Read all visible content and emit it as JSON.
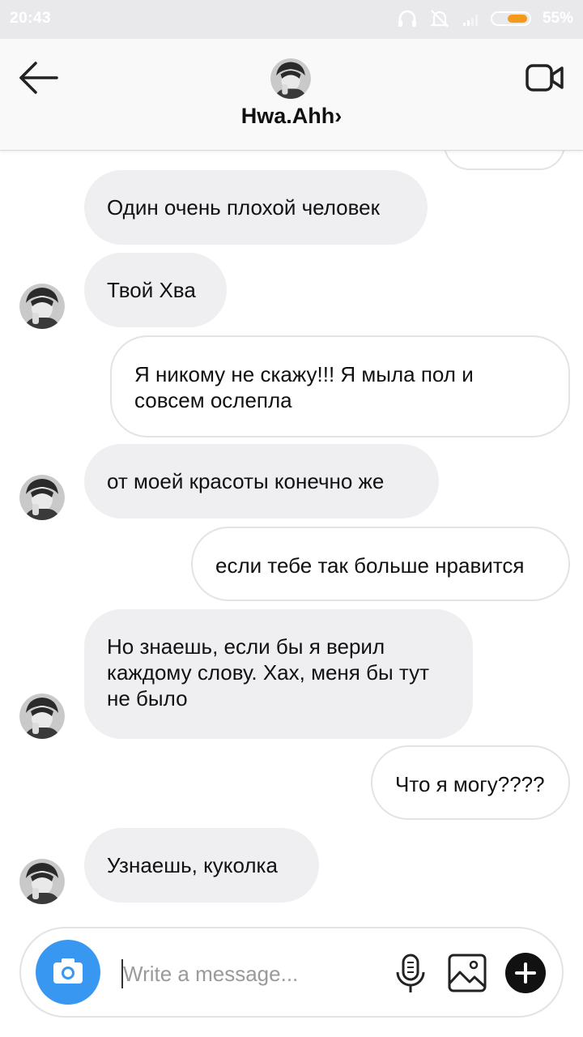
{
  "status_bar": {
    "time": "20:43",
    "battery": "55%"
  },
  "header": {
    "name": "Hwa.Ahh",
    "chevron": "›"
  },
  "messages": [
    {
      "side": "in",
      "text": "Один очень плохой человек"
    },
    {
      "side": "in",
      "text": "Твой Хва"
    },
    {
      "side": "out",
      "text": "Я никому не скажу!!! Я мыла пол и совсем ослепла"
    },
    {
      "side": "in",
      "text": "от моей красоты конечно же"
    },
    {
      "side": "out",
      "text": "если тебе так больше нравится"
    },
    {
      "side": "in",
      "text": "Но знаешь, если бы я верил каждому слову. Хах, меня бы тут не было"
    },
    {
      "side": "out",
      "text": "Что я могу????"
    },
    {
      "side": "in",
      "text": "Узнаешь, куколка"
    }
  ],
  "composer": {
    "placeholder": "Write a message...",
    "value": ""
  },
  "icons": {
    "back": "arrow-left-icon",
    "video": "video-camera-icon",
    "camera": "camera-icon",
    "mic": "microphone-icon",
    "gallery": "image-icon",
    "plus": "plus-icon",
    "headphones": "headphones-icon",
    "mute": "bell-off-icon",
    "signal": "signal-icon"
  },
  "colors": {
    "accent": "#3897f0",
    "incoming_bubble": "#efeff1",
    "battery_fill": "#f39a1a"
  }
}
